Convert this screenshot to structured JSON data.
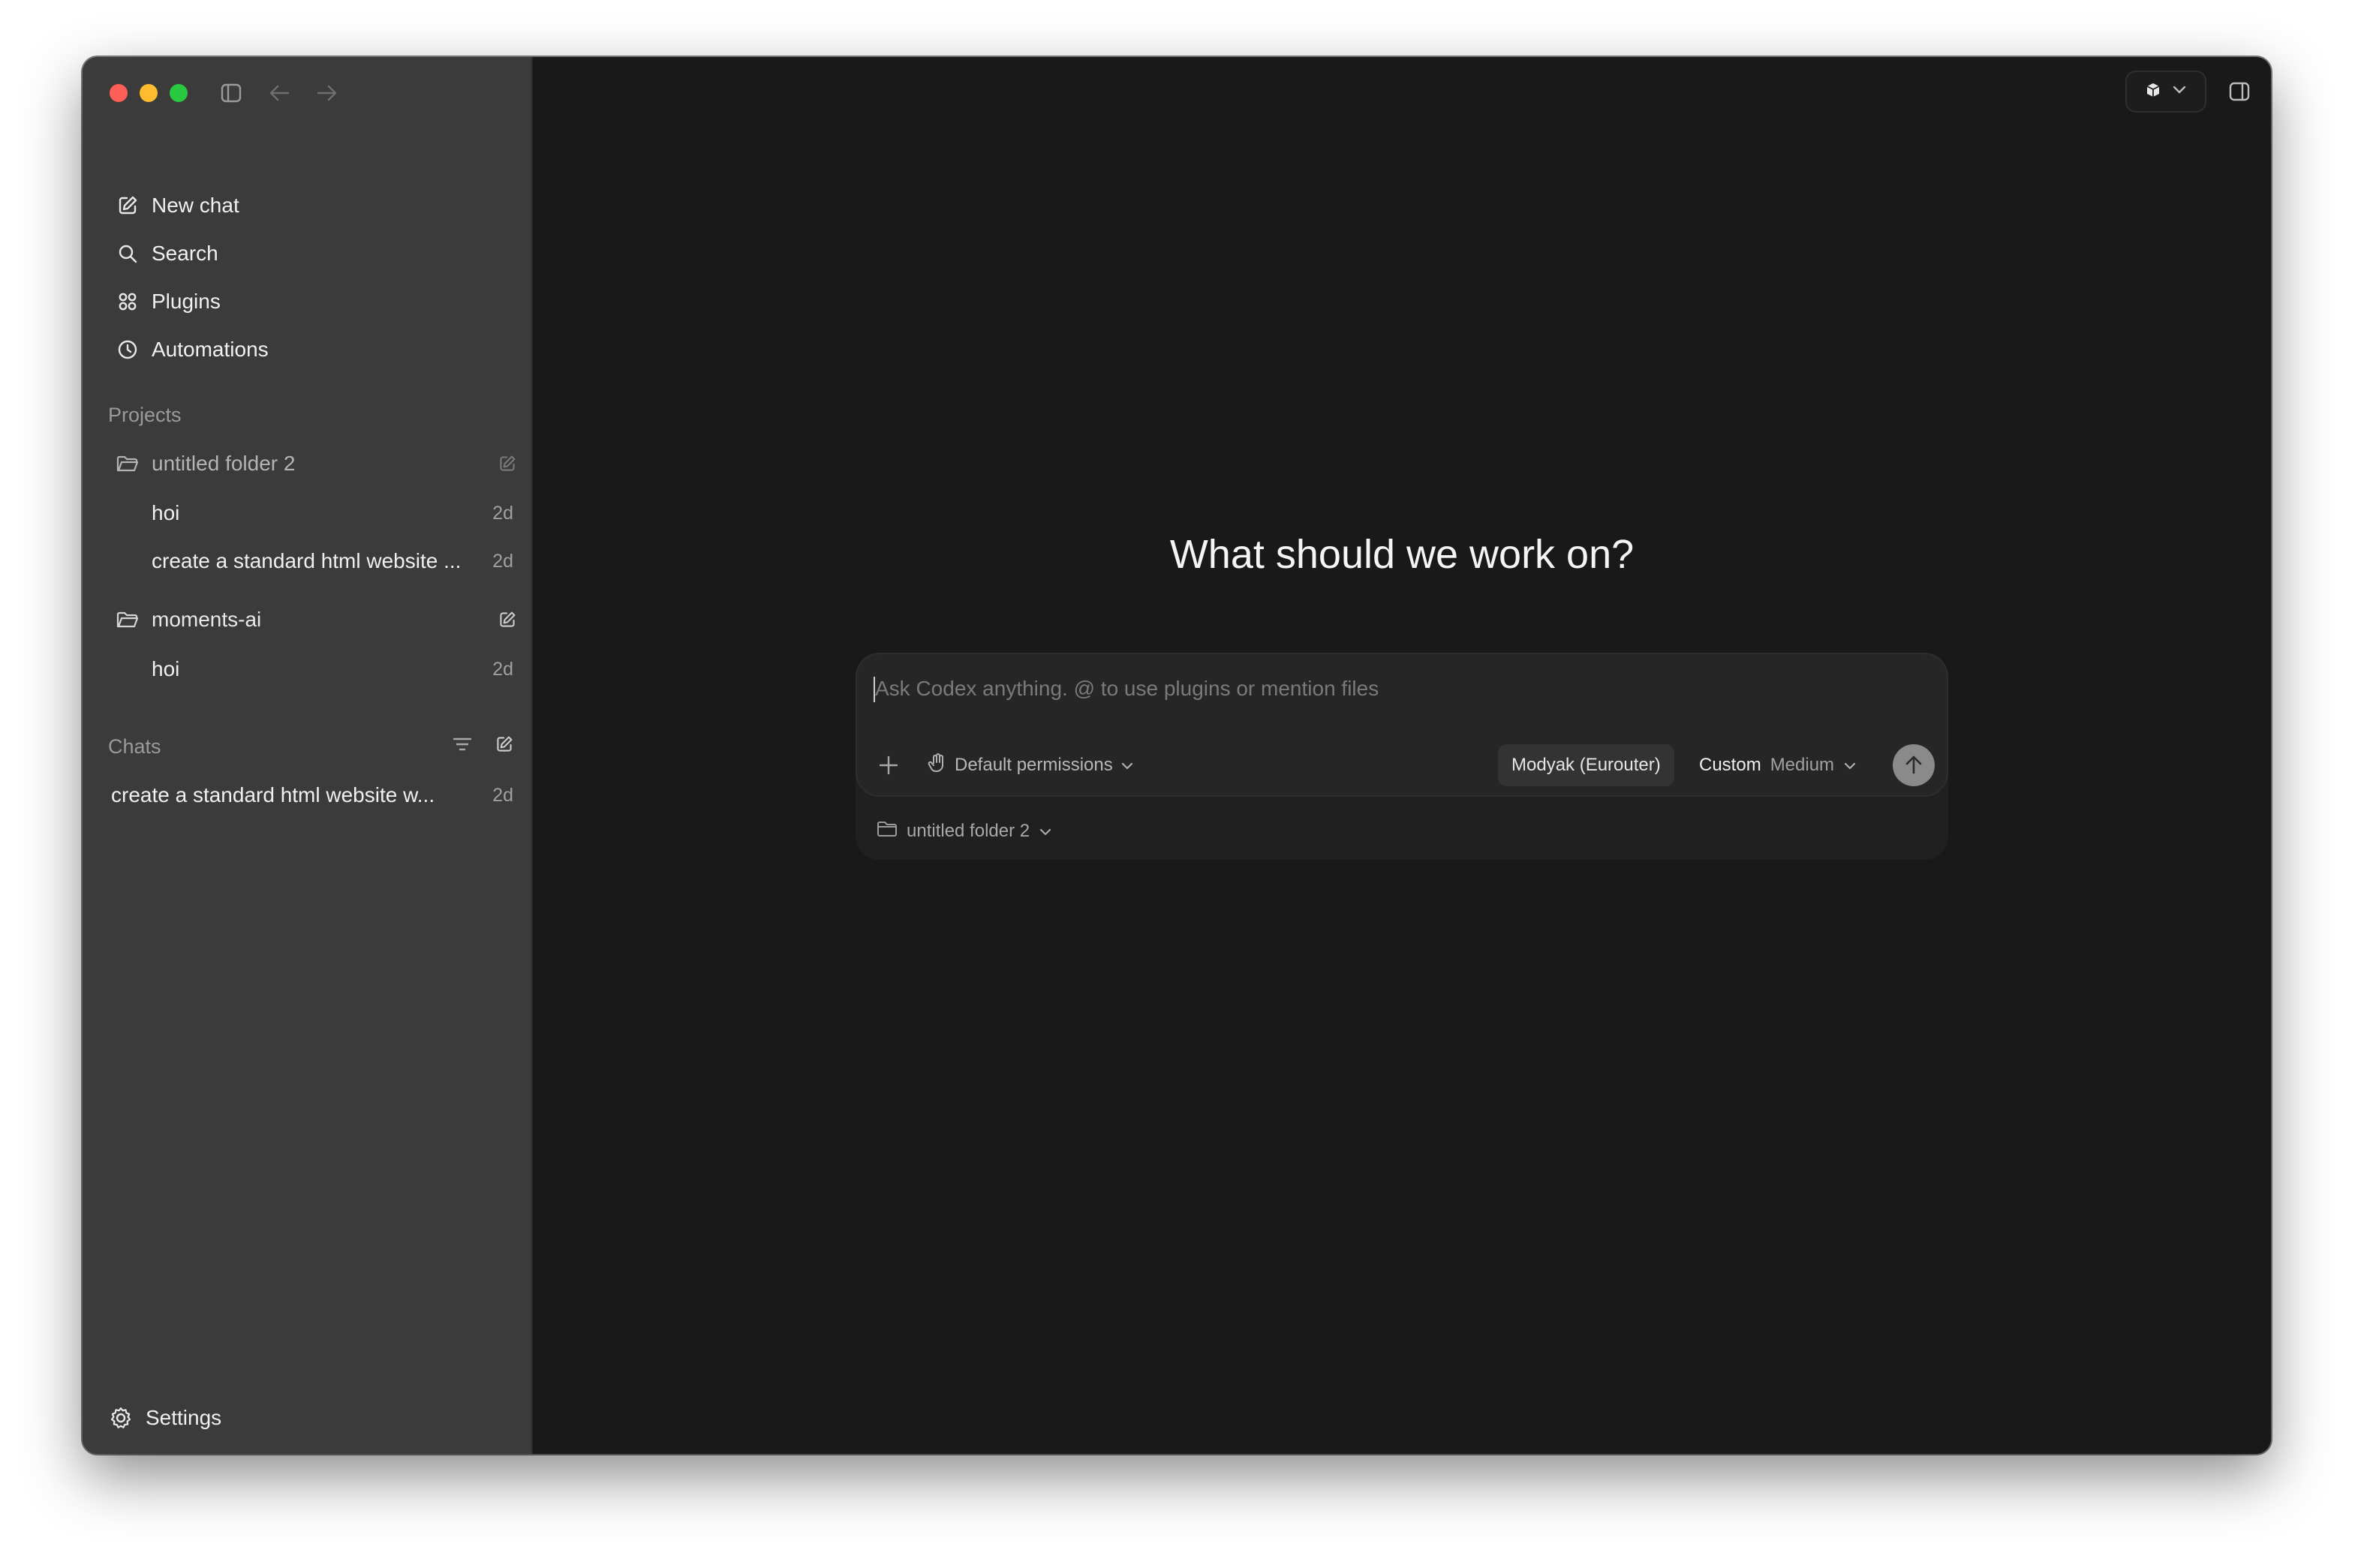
{
  "sidebar": {
    "nav": [
      {
        "label": "New chat",
        "icon": "compose-icon"
      },
      {
        "label": "Search",
        "icon": "search-icon"
      },
      {
        "label": "Plugins",
        "icon": "grid-icon"
      },
      {
        "label": "Automations",
        "icon": "clock-icon"
      }
    ],
    "projects_label": "Projects",
    "projects": [
      {
        "name": "untitled folder 2",
        "threads": [
          {
            "title": "hoi",
            "age": "2d"
          },
          {
            "title": "create a standard html website ...",
            "age": "2d"
          }
        ]
      },
      {
        "name": "moments-ai",
        "threads": [
          {
            "title": "hoi",
            "age": "2d"
          }
        ]
      }
    ],
    "chats_label": "Chats",
    "chats": [
      {
        "title": "create a standard html website w...",
        "age": "2d"
      }
    ],
    "settings_label": "Settings"
  },
  "main": {
    "headline": "What should we work on?",
    "composer": {
      "placeholder": "Ask Codex anything. @ to use plugins or mention files",
      "permissions_label": "Default permissions",
      "model_label": "Modyak (Eurouter)",
      "mode_label": "Custom",
      "effort_label": "Medium"
    },
    "folder_label": "untitled folder 2"
  },
  "colors": {
    "sidebar_bg": "#3b3b3b",
    "main_bg": "#191919",
    "traffic_red": "#ff5f57",
    "traffic_yellow": "#febc2e",
    "traffic_green": "#28c840"
  }
}
